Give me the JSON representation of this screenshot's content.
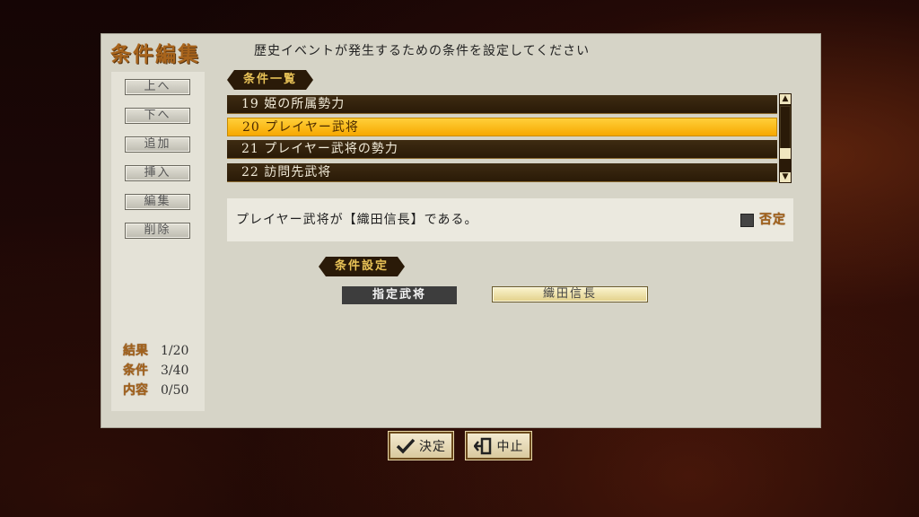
{
  "header": {
    "title": "条件編集",
    "subtitle": "歴史イベントが発生するための条件を設定してください"
  },
  "sidebar": {
    "buttons": [
      {
        "label": "上へ"
      },
      {
        "label": "下へ"
      },
      {
        "label": "追加"
      },
      {
        "label": "挿入"
      },
      {
        "label": "編集"
      },
      {
        "label": "削除"
      }
    ],
    "stats": [
      {
        "label": "結果",
        "value": "1/20"
      },
      {
        "label": "条件",
        "value": "3/40"
      },
      {
        "label": "内容",
        "value": "0/50"
      }
    ]
  },
  "condition_list": {
    "heading": "条件一覧",
    "items": [
      {
        "text": "19 姫の所属勢力",
        "selected": false
      },
      {
        "text": "20 プレイヤー武将",
        "selected": true
      },
      {
        "text": "21 プレイヤー武将の勢力",
        "selected": false
      },
      {
        "text": "22 訪問先武将",
        "selected": false
      }
    ]
  },
  "description": {
    "text": "プレイヤー武将が【織田信長】である。",
    "negate_label": "否定"
  },
  "condition_settings": {
    "heading": "条件設定",
    "field_label": "指定武将",
    "field_value": "織田信長"
  },
  "footer": {
    "confirm_label": "決定",
    "cancel_label": "中止"
  },
  "colors": {
    "accent_gold": "#a8641c",
    "selected_row": "#f7a800",
    "row_dark": "#2a1a07",
    "panel": "#d6d4c7"
  }
}
